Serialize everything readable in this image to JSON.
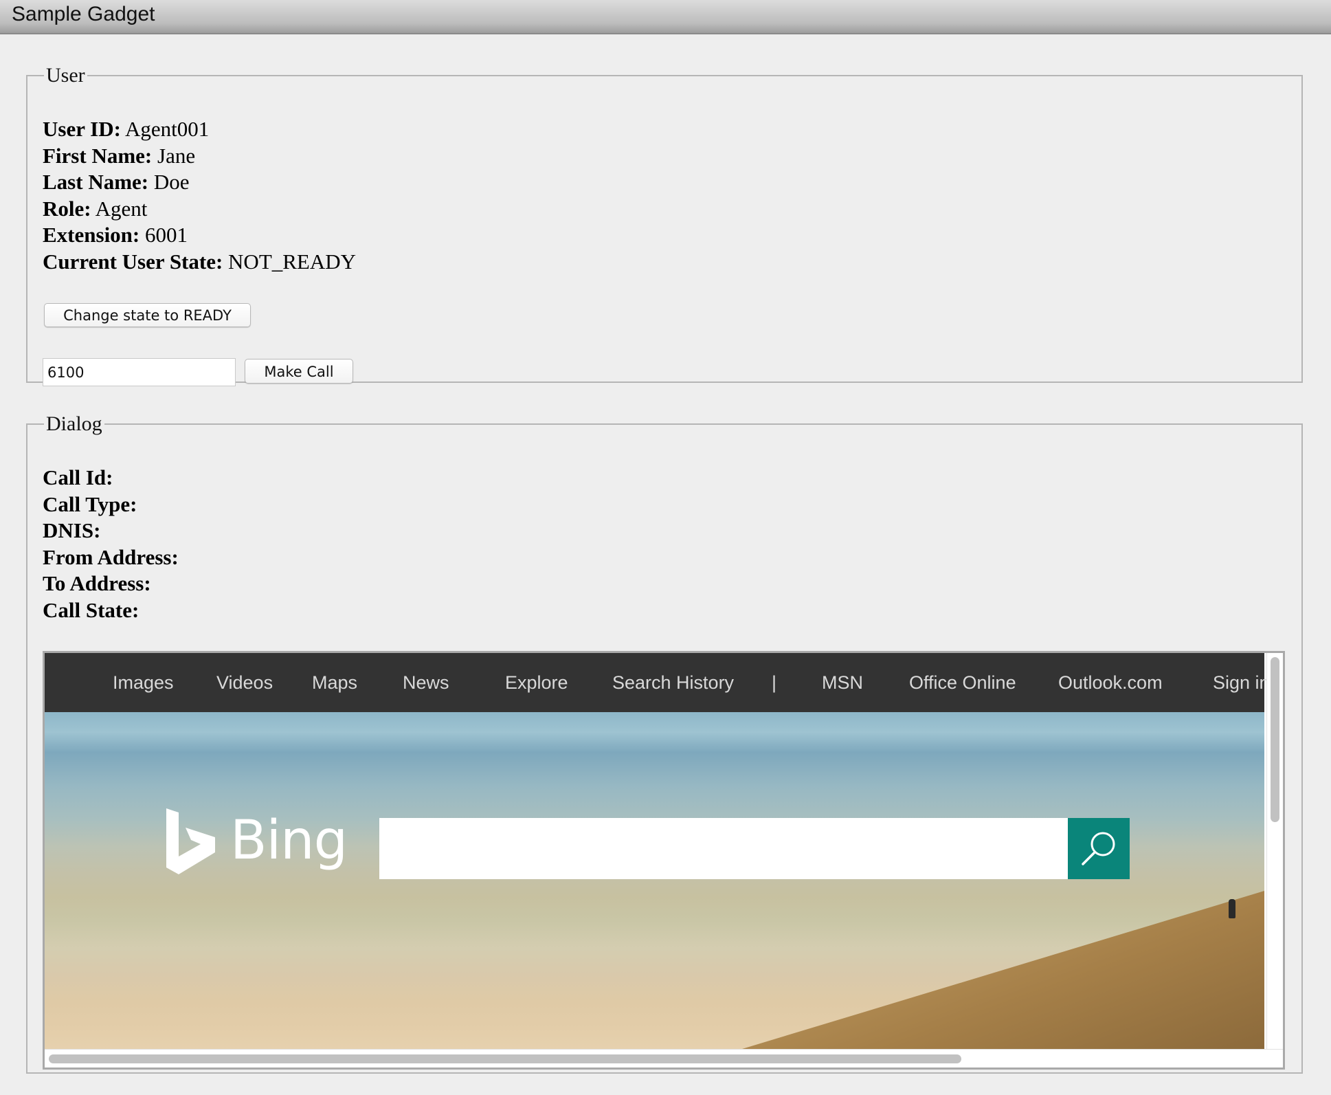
{
  "window": {
    "title": "Sample Gadget"
  },
  "user": {
    "legend": "User",
    "fields": [
      {
        "label": "User ID:",
        "value": "Agent001"
      },
      {
        "label": "First Name:",
        "value": "Jane"
      },
      {
        "label": "Last Name:",
        "value": "Doe"
      },
      {
        "label": "Role:",
        "value": "Agent"
      },
      {
        "label": "Extension:",
        "value": "6001"
      },
      {
        "label": "Current User State:",
        "value": "NOT_READY"
      }
    ],
    "change_state_button": "Change state to READY",
    "dial_number": "6100",
    "make_call_button": "Make Call"
  },
  "dialog": {
    "legend": "Dialog",
    "fields": [
      {
        "label": "Call Id:",
        "value": ""
      },
      {
        "label": "Call Type:",
        "value": ""
      },
      {
        "label": "DNIS:",
        "value": ""
      },
      {
        "label": "From Address:",
        "value": ""
      },
      {
        "label": "To Address:",
        "value": ""
      },
      {
        "label": "Call State:",
        "value": ""
      }
    ]
  },
  "embedded_browser": {
    "nav": [
      "Images",
      "Videos",
      "Maps",
      "News",
      "Explore",
      "Search History",
      "|",
      "MSN",
      "Office Online",
      "Outlook.com",
      "Sign in"
    ],
    "logo_text": "Bing",
    "search_value": "",
    "search_icon": "magnifier-icon",
    "nav_background": "#333333",
    "search_button_color": "#0a857a"
  }
}
